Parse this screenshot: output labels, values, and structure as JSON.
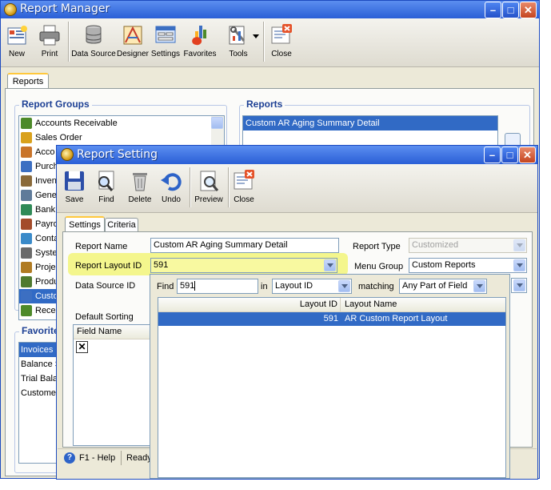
{
  "main_window": {
    "title": "Report Manager",
    "toolbar": [
      {
        "label": "New",
        "icon": "new-report-icon"
      },
      {
        "label": "Print",
        "icon": "printer-icon"
      },
      {
        "label": "Data Source",
        "icon": "database-icon"
      },
      {
        "label": "Designer",
        "icon": "designer-icon"
      },
      {
        "label": "Settings",
        "icon": "settings-icon"
      },
      {
        "label": "Favorites",
        "icon": "favorites-icon"
      },
      {
        "label": "Tools",
        "icon": "tools-icon"
      },
      {
        "label": "Close",
        "icon": "close-doc-icon"
      }
    ],
    "tab": "Reports",
    "report_groups": {
      "title": "Report Groups",
      "items": [
        {
          "label": "Accounts Receivable",
          "icon_color": "#4d8a2a"
        },
        {
          "label": "Sales Order",
          "icon_color": "#d9a11c"
        },
        {
          "label": "Acco",
          "icon_color": "#c9742a"
        },
        {
          "label": "Purch",
          "icon_color": "#3c6fc2"
        },
        {
          "label": "Inven",
          "icon_color": "#8a6a3a"
        },
        {
          "label": "Gene",
          "icon_color": "#5f7b9a"
        },
        {
          "label": "Bank",
          "icon_color": "#2f8a57"
        },
        {
          "label": "Payro",
          "icon_color": "#a34b2a"
        },
        {
          "label": "Conta",
          "icon_color": "#3a8ac9"
        },
        {
          "label": "Syste",
          "icon_color": "#6a6a6a"
        },
        {
          "label": "Proje",
          "icon_color": "#b07b22"
        },
        {
          "label": "Produ",
          "icon_color": "#4f7a2f"
        },
        {
          "label": "Custo",
          "icon_color": "#3c6fc2"
        },
        {
          "label": "Rece",
          "icon_color": "#4d8a2a"
        }
      ],
      "selected_index": 12
    },
    "reports": {
      "title": "Reports",
      "items": [
        "Custom AR Aging Summary Detail"
      ]
    },
    "favorites": {
      "title": "Favorite",
      "items": [
        "Invoices C",
        "Balance S",
        "Trial Balan",
        "Customer"
      ]
    }
  },
  "setting_window": {
    "title": "Report Setting",
    "toolbar": [
      {
        "label": "Save",
        "icon": "save-icon"
      },
      {
        "label": "Find",
        "icon": "find-icon"
      },
      {
        "label": "Delete",
        "icon": "delete-icon"
      },
      {
        "label": "Undo",
        "icon": "undo-icon"
      },
      {
        "label": "Preview",
        "icon": "preview-icon"
      },
      {
        "label": "Close",
        "icon": "close-doc-icon"
      }
    ],
    "tabs": [
      "Settings",
      "Criteria"
    ],
    "form": {
      "report_name_label": "Report Name",
      "report_name_value": "Custom AR Aging Summary Detail",
      "report_type_label": "Report Type",
      "report_type_value": "Customized",
      "layout_id_label": "Report Layout ID",
      "layout_id_value": "591",
      "menu_group_label": "Menu Group",
      "menu_group_value": "Custom Reports",
      "data_source_label": "Data Source ID",
      "default_sorting_label": "Default Sorting",
      "field_name_header": "Field Name"
    },
    "dropdown": {
      "find_label": "Find",
      "find_value": "591",
      "in_label": "in",
      "in_value": "Layout ID",
      "matching_label": "matching",
      "matching_value": "Any Part of Field",
      "columns": [
        "Layout ID",
        "Layout Name"
      ],
      "rows": [
        {
          "id": "591",
          "name": "AR Custom Report Layout"
        }
      ]
    },
    "status": {
      "help": "F1 - Help",
      "ready": "Ready"
    }
  },
  "colors": {
    "accent": "#316ac5",
    "highlight": "#f4f77a",
    "titlebar": "#2a5fd6"
  }
}
